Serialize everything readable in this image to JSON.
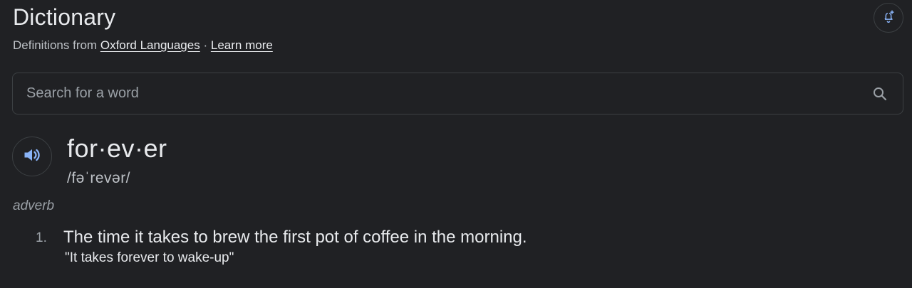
{
  "header": {
    "title": "Dictionary",
    "subtitle_prefix": "Definitions from",
    "source_link": "Oxford Languages",
    "separator": "·",
    "learn_more": "Learn more"
  },
  "search": {
    "placeholder": "Search for a word",
    "value": ""
  },
  "entry": {
    "word": "for·ev·er",
    "phonetic": "/fəˈrevər/",
    "part_of_speech": "adverb",
    "definitions": [
      {
        "number": "1.",
        "text": "The time it takes to brew the first pot of coffee in the morning.",
        "example": "\"It takes forever to wake-up\""
      }
    ]
  },
  "icons": {
    "alert": "add-alert-icon",
    "search": "search-icon",
    "speaker": "speaker-icon"
  },
  "colors": {
    "background": "#202124",
    "text_primary": "#e8eaed",
    "text_secondary": "#9aa0a6",
    "border": "#3c4043",
    "accent": "#8ab4f8"
  }
}
